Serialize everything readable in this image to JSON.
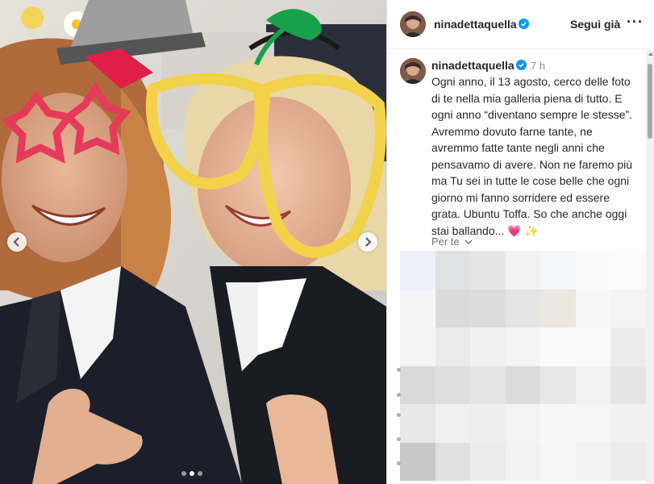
{
  "post": {
    "image_description_icon": "photo-two-women-party-glasses",
    "carousel": {
      "total": 3,
      "active_index": 1
    }
  },
  "header": {
    "username": "ninadettaquella",
    "follow_label": "Segui già",
    "more_icon": "more-horizontal-icon",
    "more_glyph": "···"
  },
  "caption": {
    "username": "ninadettaquella",
    "time": "7 h",
    "text": "Ogni anno, il 13 agosto, cerco delle foto di te nella mia galleria piena di tutto. E ogni anno “diventano sempre le stesse”. Avremmo dovuto farne tante, ne avremmo fatte tante negli anni che pensavamo di avere. Non ne faremo più ma Tu sei in tutte le cose belle che ogni giorno mi fanno sorridere ed essere grata. Ubuntu Toffa. So che anche oggi stai ballando... ",
    "emoji": "💗 ✨"
  },
  "per_te": {
    "label": "Per te"
  },
  "colors": {
    "verified": "#0095f6",
    "text": "#262626",
    "secondary": "#737373",
    "divider": "#dbdbdb"
  }
}
